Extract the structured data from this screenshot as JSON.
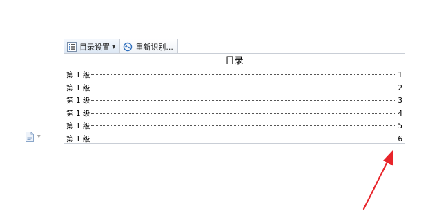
{
  "toolbar": {
    "toc_settings_label": "目录设置",
    "reidentify_label": "重新识别..."
  },
  "toc": {
    "title": "目录",
    "entries": [
      {
        "text": "第 1 级",
        "page": "1"
      },
      {
        "text": "第 1 级",
        "page": "2"
      },
      {
        "text": "第 1 级",
        "page": "3"
      },
      {
        "text": "第 1 级",
        "page": "4"
      },
      {
        "text": "第 1 级",
        "page": "5"
      },
      {
        "text": "第 1 级",
        "page": "6"
      }
    ]
  },
  "icons": {
    "toc_settings": "toc-list-icon",
    "reidentify": "refresh-icon",
    "margin_doc": "document-icon",
    "annotation": "red-arrow-icon"
  },
  "colors": {
    "annotation_arrow": "#e8242a",
    "field_border": "#c9ced6",
    "toolbar_icon_blue": "#2f6fbd"
  }
}
